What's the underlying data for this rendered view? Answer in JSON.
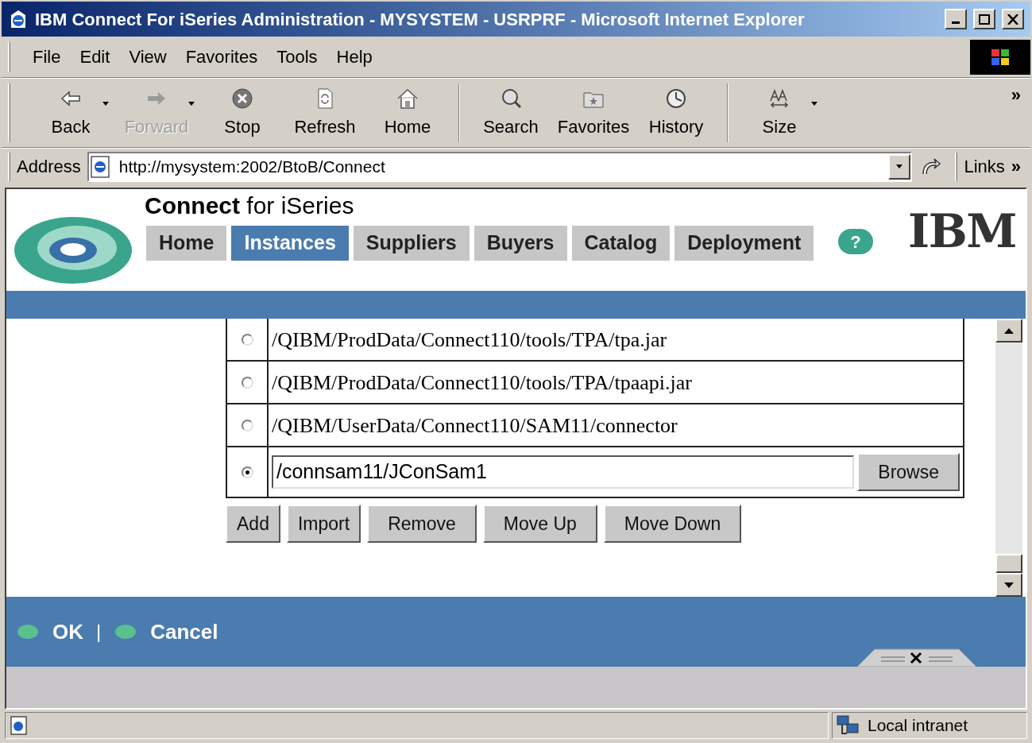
{
  "window": {
    "title": "IBM Connect For iSeries Administration - MYSYSTEM  - USRPRF - Microsoft Internet Explorer"
  },
  "menu": [
    {
      "label": "File"
    },
    {
      "label": "Edit"
    },
    {
      "label": "View"
    },
    {
      "label": "Favorites"
    },
    {
      "label": "Tools"
    },
    {
      "label": "Help"
    }
  ],
  "toolbar": {
    "overflow": "»",
    "buttons": [
      {
        "kind": "back",
        "label": "Back",
        "disabled": false,
        "dropdown": true
      },
      {
        "kind": "forward",
        "label": "Forward",
        "disabled": true,
        "dropdown": true
      },
      {
        "kind": "stop",
        "label": "Stop",
        "disabled": false,
        "dropdown": false
      },
      {
        "kind": "refresh",
        "label": "Refresh",
        "disabled": false,
        "dropdown": false
      },
      {
        "kind": "home",
        "label": "Home",
        "disabled": false,
        "dropdown": false
      },
      {
        "kind": "search",
        "label": "Search",
        "disabled": false,
        "dropdown": false
      },
      {
        "kind": "favorites",
        "label": "Favorites",
        "disabled": false,
        "dropdown": false
      },
      {
        "kind": "history",
        "label": "History",
        "disabled": false,
        "dropdown": false
      },
      {
        "kind": "size",
        "label": "Size",
        "disabled": false,
        "dropdown": true
      }
    ]
  },
  "address": {
    "label": "Address",
    "value": "http://mysystem:2002/BtoB/Connect",
    "links": "Links",
    "overflow": "»"
  },
  "app": {
    "brand": "**Connect** for iSeries",
    "logo": "IBM",
    "help": "?",
    "tabs": [
      {
        "label": "Home",
        "selected": false
      },
      {
        "label": "Instances",
        "selected": true
      },
      {
        "label": "Suppliers",
        "selected": false
      },
      {
        "label": "Buyers",
        "selected": false
      },
      {
        "label": "Catalog",
        "selected": false
      },
      {
        "label": "Deployment",
        "selected": false
      }
    ],
    "rows": [
      {
        "kind": "text",
        "path": "/QIBM/ProdData/Connect110/tools/TPA/tpa.jar",
        "selected": false
      },
      {
        "kind": "text",
        "path": "/QIBM/ProdData/Connect110/tools/TPA/tpaapi.jar",
        "selected": false
      },
      {
        "kind": "text",
        "path": "/QIBM/UserData/Connect110/SAM11/connector",
        "selected": false
      },
      {
        "kind": "input",
        "value": "/connsam11/JConSam1",
        "button": "Browse",
        "selected": true
      }
    ],
    "actions": [
      "Add",
      "Import",
      "Remove",
      "Move Up",
      "Move Down"
    ],
    "footer": {
      "ok": "OK",
      "separator": "|",
      "cancel": "Cancel"
    }
  },
  "status_bar": {
    "zone": "Local intranet"
  }
}
